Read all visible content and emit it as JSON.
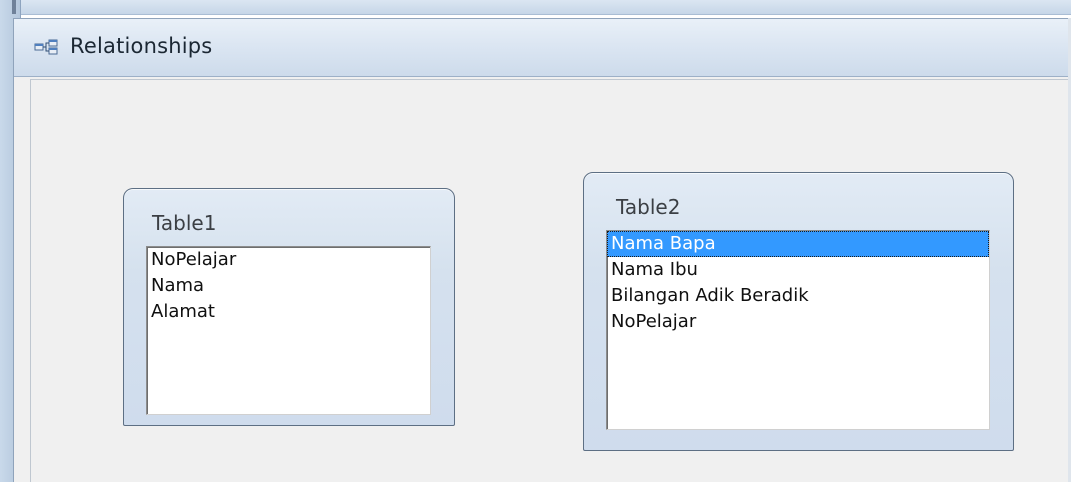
{
  "window": {
    "title": "Relationships",
    "icon": "relationships-icon"
  },
  "tables": [
    {
      "name": "Table1",
      "fields": [
        "NoPelajar",
        "Nama",
        "Alamat"
      ],
      "selected_index": -1
    },
    {
      "name": "Table2",
      "fields": [
        "Nama Bapa",
        "Nama Ibu",
        "Bilangan Adik Beradik",
        "NoPelajar"
      ],
      "selected_index": 0
    }
  ],
  "colors": {
    "selection": "#3399ff",
    "canvas": "#f0f0f0",
    "titlebar": "#d9e4f1"
  }
}
